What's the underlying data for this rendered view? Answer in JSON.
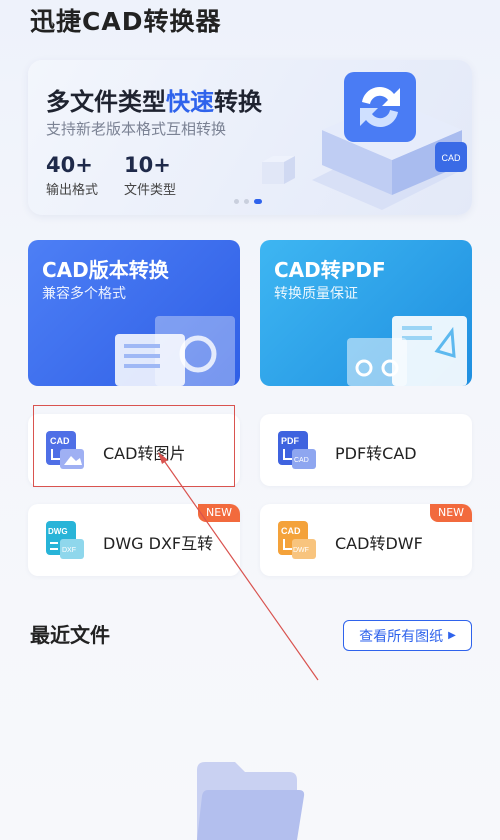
{
  "app": {
    "title": "迅捷CAD转换器"
  },
  "banner": {
    "headline_part1": "多文件类型",
    "headline_accent": "快速",
    "headline_part2": "转换",
    "subtitle": "支持新老版本格式互相转换",
    "stats": [
      {
        "value": "40+",
        "label": "输出格式"
      },
      {
        "value": "10+",
        "label": "文件类型"
      }
    ],
    "carousel_pages": 3,
    "carousel_active": 3,
    "illustration_badge": "CAD"
  },
  "feature_cards": [
    {
      "title": "CAD版本转换",
      "subtitle": "兼容多个格式",
      "color": "#3c6ff0"
    },
    {
      "title": "CAD转PDF",
      "subtitle": "转换质量保证",
      "color": "#2aa3ec"
    }
  ],
  "tools": [
    {
      "label": "CAD转图片",
      "icon_text": "CAD",
      "icon": "image-convert-icon",
      "new": false
    },
    {
      "label": "PDF转CAD",
      "icon_text": "PDF",
      "icon_sub": "CAD",
      "icon": "pdf-to-cad-icon",
      "new": false
    },
    {
      "label": "DWG DXF互转",
      "icon_text": "DWG",
      "icon_sub": "DXF",
      "icon": "dwg-dxf-icon",
      "new": true
    },
    {
      "label": "CAD转DWF",
      "icon_text": "CAD",
      "icon_sub": "DWF",
      "icon": "cad-to-dwf-icon",
      "new": true
    }
  ],
  "new_badge": "NEW",
  "recent": {
    "title": "最近文件",
    "view_all": "查看所有图纸"
  },
  "colors": {
    "accent": "#2f63ec",
    "new": "#f26a3d",
    "highlight": "#d9534f"
  }
}
